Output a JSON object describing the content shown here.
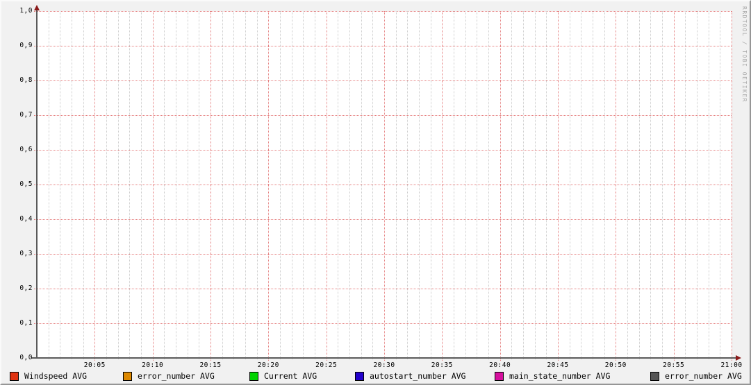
{
  "watermark": "RRDTOOL / TOBI OETIKER",
  "colors": {
    "background": "#f1f1f1",
    "canvas": "#ffffff",
    "grid_major": "#e57f7f",
    "grid_minor": "#cccccc",
    "axis": "#5a5a5a",
    "arrow": "#8b1a1a",
    "text": "#000000",
    "watermark": "#a8a8a8",
    "bevel_light": "#fafafa",
    "bevel_dark": "#969696",
    "legend_swatch_border": "#000000"
  },
  "chart_data": {
    "type": "line",
    "title": "",
    "xlabel": "",
    "ylabel": "",
    "x_range_time": [
      "20:00",
      "21:00"
    ],
    "x_tick_labels": [
      "20:05",
      "20:10",
      "20:15",
      "20:20",
      "20:25",
      "20:30",
      "20:35",
      "20:40",
      "20:45",
      "20:50",
      "20:55",
      "21:00"
    ],
    "x_minor_ticks_per_major": 5,
    "ylim": [
      0.0,
      1.0
    ],
    "y_tick_step": 0.1,
    "y_tick_labels_top_down": [
      "1,0",
      "0,9",
      "0,8",
      "0,7",
      "0,6",
      "0,5",
      "0,4",
      "0,3",
      "0,2",
      "0,1",
      "0,0"
    ],
    "decimal_separator": ",",
    "grid": true,
    "legend_position": "bottom",
    "series": [
      {
        "label": "Windspeed AVG",
        "color": "#e03210",
        "values": []
      },
      {
        "label": "error_number AVG",
        "color": "#dd8800",
        "values": []
      },
      {
        "label": "Current AVG",
        "color": "#00d300",
        "values": []
      },
      {
        "label": "autostart_number AVG",
        "color": "#2200cc",
        "values": []
      },
      {
        "label": "main_state_number AVG",
        "color": "#d6109e",
        "values": []
      },
      {
        "label": "error_number AVG",
        "color": "#555555",
        "values": []
      }
    ]
  }
}
